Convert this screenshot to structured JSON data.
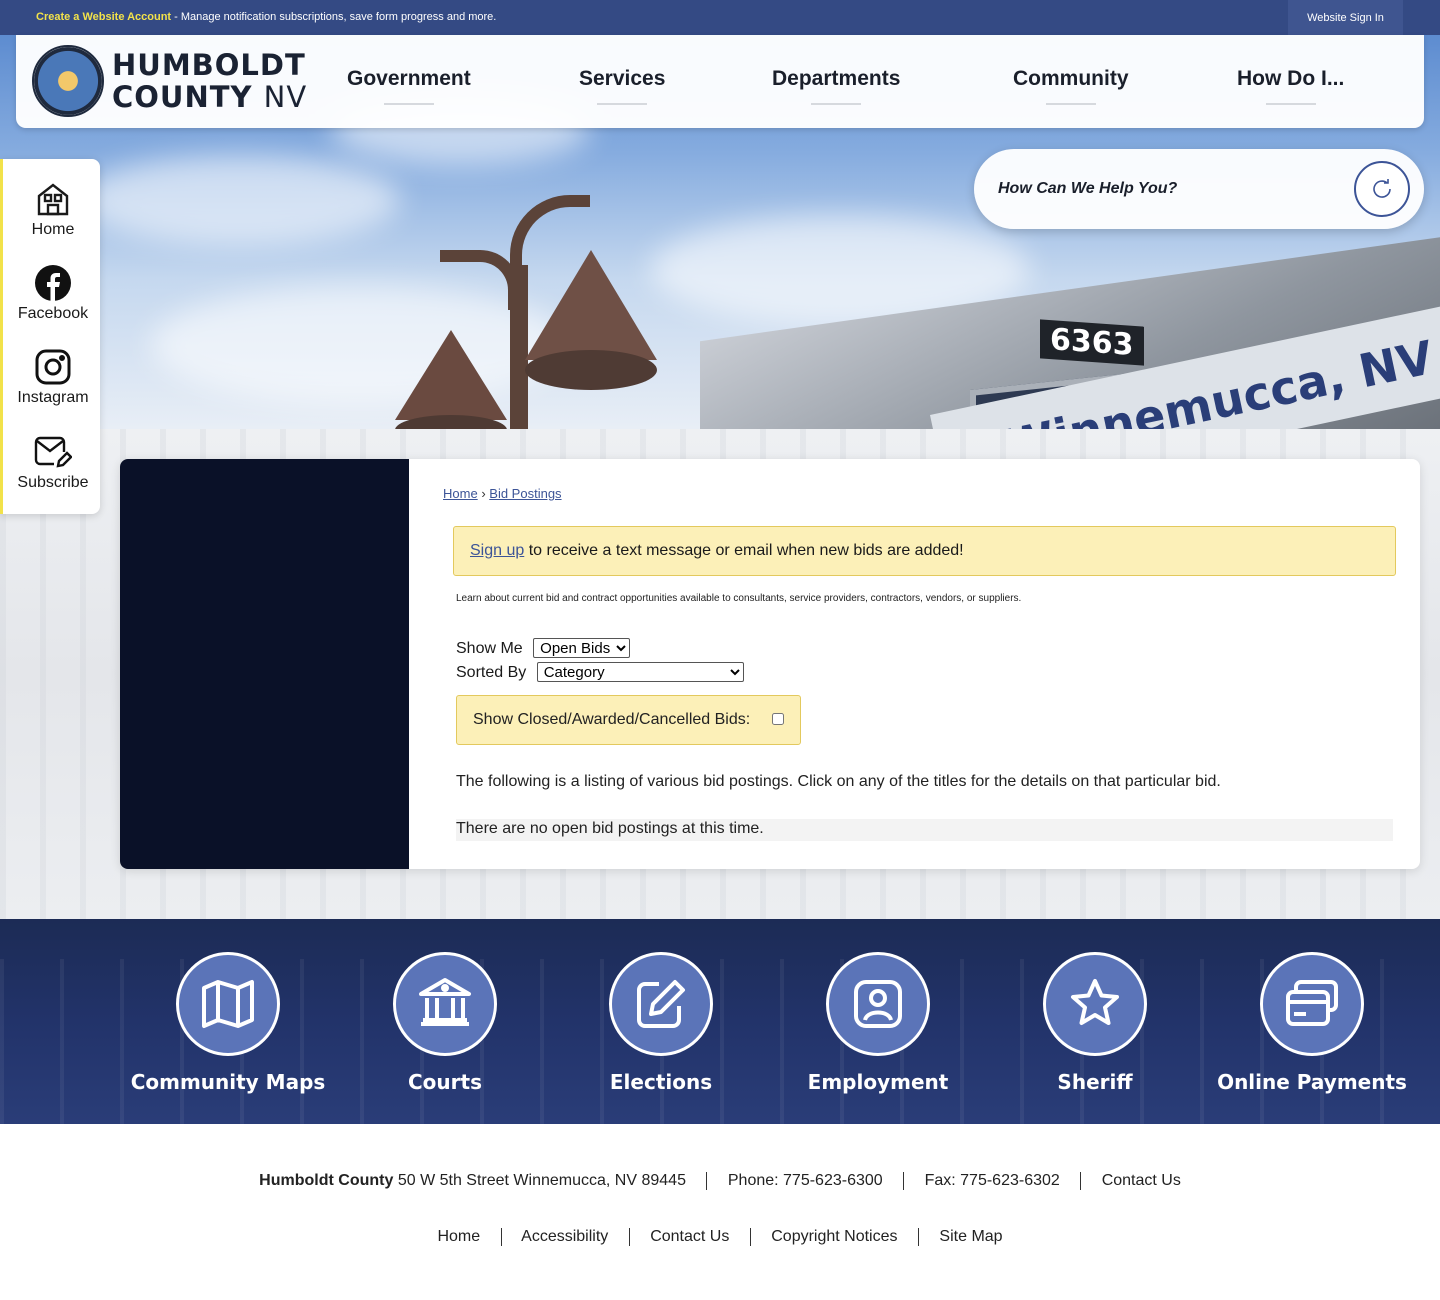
{
  "topbar": {
    "create_account_link": "Create a Website Account",
    "promo_text": " - Manage notification subscriptions, save form progress and more.",
    "sign_in": "Website Sign In"
  },
  "logo": {
    "line1": "HUMBOLDT",
    "line2_bold": "COUNTY",
    "line2_light": "NV"
  },
  "nav": {
    "items": [
      "Government",
      "Services",
      "Departments",
      "Community",
      "How Do I..."
    ]
  },
  "hero": {
    "train_number": "6363",
    "sign_text": "Winnemucca, NV"
  },
  "search": {
    "placeholder": "How Can We Help You?",
    "icon": "search-icon"
  },
  "social": {
    "items": [
      {
        "label": "Home",
        "icon": "home-icon"
      },
      {
        "label": "Facebook",
        "icon": "facebook-icon"
      },
      {
        "label": "Instagram",
        "icon": "instagram-icon"
      },
      {
        "label": "Subscribe",
        "icon": "subscribe-icon"
      }
    ]
  },
  "breadcrumb": {
    "home": "Home",
    "separator": "›",
    "current": "Bid Postings"
  },
  "alert": {
    "link": "Sign up",
    "text": " to receive a text message or email when new bids are added!"
  },
  "intro": "Learn about current bid and contract opportunities available to consultants, service providers, contractors, vendors, or suppliers.",
  "filters": {
    "show_me_label": "Show Me",
    "show_me_value": "Open Bids",
    "sorted_by_label": "Sorted By",
    "sorted_by_value": "Category",
    "show_closed_label": "Show Closed/Awarded/Cancelled Bids:"
  },
  "listing_text": "The following is a listing of various bid postings. Click on any of the titles for the details on that particular bid.",
  "no_bids": "There are no open bid postings at this time.",
  "quick_links": [
    {
      "label": "Community Maps",
      "icon": "map-icon"
    },
    {
      "label": "Courts",
      "icon": "courthouse-icon"
    },
    {
      "label": "Elections",
      "icon": "edit-icon"
    },
    {
      "label": "Employment",
      "icon": "user-badge-icon"
    },
    {
      "label": "Sheriff",
      "icon": "star-icon"
    },
    {
      "label": "Online Payments",
      "icon": "credit-card-icon"
    }
  ],
  "footer": {
    "org_name": "Humboldt County",
    "address": " 50 W 5th Street Winnemucca, NV 89445",
    "phone": "Phone: 775-623-6300",
    "fax": "Fax: 775-623-6302",
    "contact": "Contact Us",
    "links": [
      "Home",
      "Accessibility",
      "Contact Us",
      "Copyright Notices",
      "Site Map"
    ]
  },
  "colors": {
    "topbar": "#344a84",
    "accent_yellow": "#f2e24a",
    "alert_bg": "#fcf0b8",
    "link": "#3c5497",
    "card_side": "#0a1128",
    "quick_circle": "#5b74b8"
  }
}
